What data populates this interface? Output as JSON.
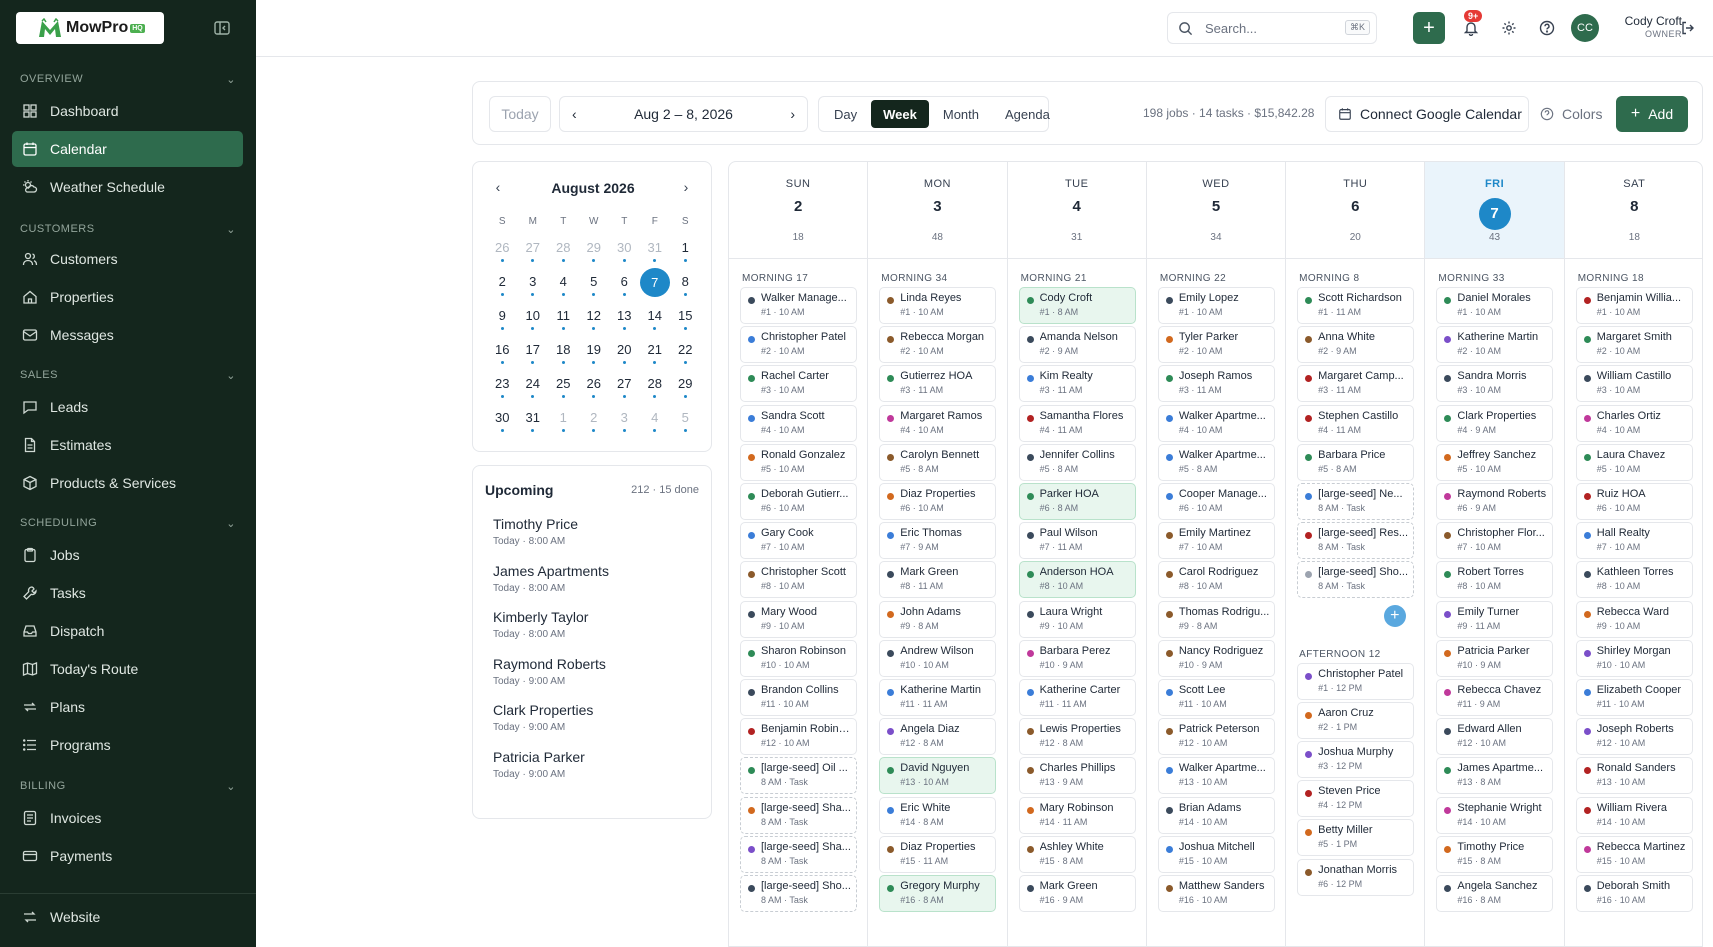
{
  "brand": {
    "name": "MowPro",
    "tag": "HQ"
  },
  "sidebar": {
    "sections": [
      {
        "label": "OVERVIEW"
      },
      {
        "label": "CUSTOMERS"
      },
      {
        "label": "SALES"
      },
      {
        "label": "SCHEDULING"
      },
      {
        "label": "BILLING"
      }
    ],
    "items": [
      {
        "label": "Dashboard"
      },
      {
        "label": "Calendar"
      },
      {
        "label": "Weather Schedule"
      },
      {
        "label": "Customers"
      },
      {
        "label": "Properties"
      },
      {
        "label": "Messages"
      },
      {
        "label": "Leads"
      },
      {
        "label": "Estimates"
      },
      {
        "label": "Products & Services"
      },
      {
        "label": "Jobs"
      },
      {
        "label": "Tasks"
      },
      {
        "label": "Dispatch"
      },
      {
        "label": "Today's Route"
      },
      {
        "label": "Plans"
      },
      {
        "label": "Programs"
      },
      {
        "label": "Invoices"
      },
      {
        "label": "Payments"
      },
      {
        "label": "Website"
      }
    ]
  },
  "topbar": {
    "search_placeholder": "Search...",
    "search_kbd": "⌘K",
    "notif_badge": "9+",
    "avatar_initials": "CC",
    "user_name": "Cody Croft",
    "user_role": "OWNER"
  },
  "toolbar": {
    "today": "Today",
    "range": "Aug 2 – 8, 2026",
    "views": [
      "Day",
      "Week",
      "Month",
      "Agenda"
    ],
    "active_view": "Week",
    "stats": "198 jobs · 14 tasks · $15,842.28",
    "gcal": "Connect Google Calendar",
    "colors": "Colors",
    "add": "Add"
  },
  "mini_calendar": {
    "title": "August 2026",
    "dow": [
      "S",
      "M",
      "T",
      "W",
      "T",
      "F",
      "S"
    ],
    "weeks": [
      [
        "26",
        "27",
        "28",
        "29",
        "30",
        "31",
        "1"
      ],
      [
        "2",
        "3",
        "4",
        "5",
        "6",
        "7",
        "8"
      ],
      [
        "9",
        "10",
        "11",
        "12",
        "13",
        "14",
        "15"
      ],
      [
        "16",
        "17",
        "18",
        "19",
        "20",
        "21",
        "22"
      ],
      [
        "23",
        "24",
        "25",
        "26",
        "27",
        "28",
        "29"
      ],
      [
        "30",
        "31",
        "1",
        "2",
        "3",
        "4",
        "5"
      ]
    ],
    "selected": "7"
  },
  "upcoming": {
    "title": "Upcoming",
    "count": "212 · 15 done",
    "items": [
      {
        "name": "Timothy Price",
        "time": "Today · 8:00 AM"
      },
      {
        "name": "James Apartments",
        "time": "Today · 8:00 AM"
      },
      {
        "name": "Kimberly Taylor",
        "time": "Today · 8:00 AM"
      },
      {
        "name": "Raymond Roberts",
        "time": "Today · 9:00 AM"
      },
      {
        "name": "Clark Properties",
        "time": "Today · 9:00 AM"
      },
      {
        "name": "Patricia Parker",
        "time": "Today · 9:00 AM"
      }
    ]
  },
  "week": {
    "days": [
      {
        "dow": "SUN",
        "num": "2",
        "count": "18",
        "morning": "MORNING 17",
        "today": false,
        "events": [
          {
            "t": "Walker Manage...",
            "s": "#1 · 10 AM",
            "c": "#3b4a5c"
          },
          {
            "t": "Christopher Patel",
            "s": "#2 · 10 AM",
            "c": "#3b7dd8"
          },
          {
            "t": "Rachel Carter",
            "s": "#3 · 10 AM",
            "c": "#2e8b57"
          },
          {
            "t": "Sandra Scott",
            "s": "#4 · 10 AM",
            "c": "#3b7dd8"
          },
          {
            "t": "Ronald Gonzalez",
            "s": "#5 · 10 AM",
            "c": "#d2691e"
          },
          {
            "t": "Deborah Gutierr...",
            "s": "#6 · 10 AM",
            "c": "#2e8b57"
          },
          {
            "t": "Gary Cook",
            "s": "#7 · 10 AM",
            "c": "#3b7dd8"
          },
          {
            "t": "Christopher Scott",
            "s": "#8 · 10 AM",
            "c": "#8b5a2b"
          },
          {
            "t": "Mary Wood",
            "s": "#9 · 10 AM",
            "c": "#3b4a5c"
          },
          {
            "t": "Sharon Robinson",
            "s": "#10 · 10 AM",
            "c": "#2e8b57"
          },
          {
            "t": "Brandon Collins",
            "s": "#11 · 10 AM",
            "c": "#3b4a5c"
          },
          {
            "t": "Benjamin Robins...",
            "s": "#12 · 10 AM",
            "c": "#b22222"
          },
          {
            "t": "[large-seed] Oil ...",
            "s": "8 AM · Task",
            "c": "#2e8b57",
            "task": true
          },
          {
            "t": "[large-seed] Sha...",
            "s": "8 AM · Task",
            "c": "#d2691e",
            "task": true
          },
          {
            "t": "[large-seed] Sha...",
            "s": "8 AM · Task",
            "c": "#7b4fc9",
            "task": true
          },
          {
            "t": "[large-seed] Sho...",
            "s": "8 AM · Task",
            "c": "#3b4a5c",
            "task": true
          }
        ]
      },
      {
        "dow": "MON",
        "num": "3",
        "count": "48",
        "morning": "MORNING 34",
        "today": false,
        "events": [
          {
            "t": "Linda Reyes",
            "s": "#1 · 10 AM",
            "c": "#8b5a2b"
          },
          {
            "t": "Rebecca Morgan",
            "s": "#2 · 10 AM",
            "c": "#8b5a2b"
          },
          {
            "t": "Gutierrez HOA",
            "s": "#3 · 11 AM",
            "c": "#2e8b57"
          },
          {
            "t": "Margaret Ramos",
            "s": "#4 · 10 AM",
            "c": "#c0399b"
          },
          {
            "t": "Carolyn Bennett",
            "s": "#5 · 8 AM",
            "c": "#8b5a2b"
          },
          {
            "t": "Diaz Properties",
            "s": "#6 · 10 AM",
            "c": "#d2691e"
          },
          {
            "t": "Eric Thomas",
            "s": "#7 · 9 AM",
            "c": "#3b7dd8"
          },
          {
            "t": "Mark Green",
            "s": "#8 · 11 AM",
            "c": "#3b4a5c"
          },
          {
            "t": "John Adams",
            "s": "#9 · 8 AM",
            "c": "#d2691e"
          },
          {
            "t": "Andrew Wilson",
            "s": "#10 · 10 AM",
            "c": "#3b4a5c"
          },
          {
            "t": "Katherine Martin",
            "s": "#11 · 11 AM",
            "c": "#3b7dd8"
          },
          {
            "t": "Angela Diaz",
            "s": "#12 · 8 AM",
            "c": "#7b4fc9"
          },
          {
            "t": "David Nguyen",
            "s": "#13 · 10 AM",
            "c": "#2e8b57",
            "green": true
          },
          {
            "t": "Eric White",
            "s": "#14 · 8 AM",
            "c": "#3b7dd8"
          },
          {
            "t": "Diaz Properties",
            "s": "#15 · 11 AM",
            "c": "#8b5a2b"
          },
          {
            "t": "Gregory Murphy",
            "s": "#16 · 8 AM",
            "c": "#2e8b57",
            "green": true
          }
        ]
      },
      {
        "dow": "TUE",
        "num": "4",
        "count": "31",
        "morning": "MORNING 21",
        "today": false,
        "events": [
          {
            "t": "Cody Croft",
            "s": "#1 · 8 AM",
            "c": "#2e8b57",
            "green": true
          },
          {
            "t": "Amanda Nelson",
            "s": "#2 · 9 AM",
            "c": "#3b4a5c"
          },
          {
            "t": "Kim Realty",
            "s": "#3 · 11 AM",
            "c": "#3b7dd8"
          },
          {
            "t": "Samantha Flores",
            "s": "#4 · 11 AM",
            "c": "#b22222"
          },
          {
            "t": "Jennifer Collins",
            "s": "#5 · 8 AM",
            "c": "#3b4a5c"
          },
          {
            "t": "Parker HOA",
            "s": "#6 · 8 AM",
            "c": "#2e8b57",
            "green": true
          },
          {
            "t": "Paul Wilson",
            "s": "#7 · 11 AM",
            "c": "#3b4a5c"
          },
          {
            "t": "Anderson HOA",
            "s": "#8 · 10 AM",
            "c": "#2e8b57",
            "green": true
          },
          {
            "t": "Laura Wright",
            "s": "#9 · 10 AM",
            "c": "#3b4a5c"
          },
          {
            "t": "Barbara Perez",
            "s": "#10 · 9 AM",
            "c": "#c0399b"
          },
          {
            "t": "Katherine Carter",
            "s": "#11 · 11 AM",
            "c": "#3b7dd8"
          },
          {
            "t": "Lewis Properties",
            "s": "#12 · 8 AM",
            "c": "#8b5a2b"
          },
          {
            "t": "Charles Phillips",
            "s": "#13 · 9 AM",
            "c": "#8b5a2b"
          },
          {
            "t": "Mary Robinson",
            "s": "#14 · 11 AM",
            "c": "#d2691e"
          },
          {
            "t": "Ashley White",
            "s": "#15 · 8 AM",
            "c": "#8b5a2b"
          },
          {
            "t": "Mark Green",
            "s": "#16 · 9 AM",
            "c": "#3b4a5c"
          }
        ]
      },
      {
        "dow": "WED",
        "num": "5",
        "count": "34",
        "morning": "MORNING 22",
        "today": false,
        "events": [
          {
            "t": "Emily Lopez",
            "s": "#1 · 10 AM",
            "c": "#3b4a5c"
          },
          {
            "t": "Tyler Parker",
            "s": "#2 · 10 AM",
            "c": "#d2691e"
          },
          {
            "t": "Joseph Ramos",
            "s": "#3 · 11 AM",
            "c": "#2e8b57"
          },
          {
            "t": "Walker Apartme...",
            "s": "#4 · 10 AM",
            "c": "#3b7dd8"
          },
          {
            "t": "Walker Apartme...",
            "s": "#5 · 8 AM",
            "c": "#3b7dd8"
          },
          {
            "t": "Cooper Manage...",
            "s": "#6 · 10 AM",
            "c": "#3b7dd8"
          },
          {
            "t": "Emily Martinez",
            "s": "#7 · 10 AM",
            "c": "#8b5a2b"
          },
          {
            "t": "Carol Rodriguez",
            "s": "#8 · 10 AM",
            "c": "#8b5a2b"
          },
          {
            "t": "Thomas Rodrigu...",
            "s": "#9 · 8 AM",
            "c": "#8b5a2b"
          },
          {
            "t": "Nancy Rodriguez",
            "s": "#10 · 9 AM",
            "c": "#8b5a2b"
          },
          {
            "t": "Scott Lee",
            "s": "#11 · 10 AM",
            "c": "#3b7dd8"
          },
          {
            "t": "Patrick Peterson",
            "s": "#12 · 10 AM",
            "c": "#8b5a2b"
          },
          {
            "t": "Walker Apartme...",
            "s": "#13 · 10 AM",
            "c": "#3b7dd8"
          },
          {
            "t": "Brian Adams",
            "s": "#14 · 10 AM",
            "c": "#3b4a5c"
          },
          {
            "t": "Joshua Mitchell",
            "s": "#15 · 10 AM",
            "c": "#3b7dd8"
          },
          {
            "t": "Matthew Sanders",
            "s": "#16 · 10 AM",
            "c": "#8b5a2b"
          }
        ]
      },
      {
        "dow": "THU",
        "num": "6",
        "count": "20",
        "morning": "MORNING 8",
        "afternoon": "AFTERNOON 12",
        "today": false,
        "events": [
          {
            "t": "Scott Richardson",
            "s": "#1 · 11 AM",
            "c": "#2e8b57"
          },
          {
            "t": "Anna White",
            "s": "#2 · 9 AM",
            "c": "#8b5a2b"
          },
          {
            "t": "Margaret Camp...",
            "s": "#3 · 11 AM",
            "c": "#b22222"
          },
          {
            "t": "Stephen Castillo",
            "s": "#4 · 11 AM",
            "c": "#b22222"
          },
          {
            "t": "Barbara Price",
            "s": "#5 · 8 AM",
            "c": "#2e8b57"
          },
          {
            "t": "[large-seed] Ne...",
            "s": "8 AM · Task",
            "c": "#3b7dd8",
            "task": true
          },
          {
            "t": "[large-seed] Res...",
            "s": "8 AM · Task",
            "c": "#b22222",
            "task": true
          },
          {
            "t": "[large-seed] Sho...",
            "s": "8 AM · Task",
            "c": "#9ca3af",
            "task": true
          }
        ],
        "afternoon_events": [
          {
            "t": "Christopher Patel",
            "s": "#1 · 12 PM",
            "c": "#7b4fc9"
          },
          {
            "t": "Aaron Cruz",
            "s": "#2 · 1 PM",
            "c": "#d2691e"
          },
          {
            "t": "Joshua Murphy",
            "s": "#3 · 12 PM",
            "c": "#7b4fc9"
          },
          {
            "t": "Steven Price",
            "s": "#4 · 12 PM",
            "c": "#b22222"
          },
          {
            "t": "Betty Miller",
            "s": "#5 · 1 PM",
            "c": "#d2691e"
          },
          {
            "t": "Jonathan Morris",
            "s": "#6 · 12 PM",
            "c": "#8b5a2b"
          }
        ]
      },
      {
        "dow": "FRI",
        "num": "7",
        "count": "43",
        "morning": "MORNING 33",
        "today": true,
        "events": [
          {
            "t": "Daniel Morales",
            "s": "#1 · 10 AM",
            "c": "#2e8b57"
          },
          {
            "t": "Katherine Martin",
            "s": "#2 · 10 AM",
            "c": "#7b4fc9"
          },
          {
            "t": "Sandra Morris",
            "s": "#3 · 10 AM",
            "c": "#3b4a5c"
          },
          {
            "t": "Clark Properties",
            "s": "#4 · 9 AM",
            "c": "#2e8b57"
          },
          {
            "t": "Jeffrey Sanchez",
            "s": "#5 · 10 AM",
            "c": "#d2691e"
          },
          {
            "t": "Raymond Roberts",
            "s": "#6 · 9 AM",
            "c": "#c0399b"
          },
          {
            "t": "Christopher Flor...",
            "s": "#7 · 10 AM",
            "c": "#8b5a2b"
          },
          {
            "t": "Robert Torres",
            "s": "#8 · 10 AM",
            "c": "#2e8b57"
          },
          {
            "t": "Emily Turner",
            "s": "#9 · 11 AM",
            "c": "#7b4fc9"
          },
          {
            "t": "Patricia Parker",
            "s": "#10 · 9 AM",
            "c": "#d2691e"
          },
          {
            "t": "Rebecca Chavez",
            "s": "#11 · 9 AM",
            "c": "#c0399b"
          },
          {
            "t": "Edward Allen",
            "s": "#12 · 10 AM",
            "c": "#3b4a5c"
          },
          {
            "t": "James Apartme...",
            "s": "#13 · 8 AM",
            "c": "#2e8b57"
          },
          {
            "t": "Stephanie Wright",
            "s": "#14 · 10 AM",
            "c": "#c0399b"
          },
          {
            "t": "Timothy Price",
            "s": "#15 · 8 AM",
            "c": "#d2691e"
          },
          {
            "t": "Angela Sanchez",
            "s": "#16 · 8 AM",
            "c": "#3b4a5c"
          }
        ]
      },
      {
        "dow": "SAT",
        "num": "8",
        "count": "18",
        "morning": "MORNING 18",
        "today": false,
        "events": [
          {
            "t": "Benjamin Willia...",
            "s": "#1 · 10 AM",
            "c": "#b22222"
          },
          {
            "t": "Margaret Smith",
            "s": "#2 · 10 AM",
            "c": "#2e8b57"
          },
          {
            "t": "William Castillo",
            "s": "#3 · 10 AM",
            "c": "#3b4a5c"
          },
          {
            "t": "Charles Ortiz",
            "s": "#4 · 10 AM",
            "c": "#c0399b"
          },
          {
            "t": "Laura Chavez",
            "s": "#5 · 10 AM",
            "c": "#2e8b57"
          },
          {
            "t": "Ruiz HOA",
            "s": "#6 · 10 AM",
            "c": "#b22222"
          },
          {
            "t": "Hall Realty",
            "s": "#7 · 10 AM",
            "c": "#3b7dd8"
          },
          {
            "t": "Kathleen Torres",
            "s": "#8 · 10 AM",
            "c": "#3b4a5c"
          },
          {
            "t": "Rebecca Ward",
            "s": "#9 · 10 AM",
            "c": "#d2691e"
          },
          {
            "t": "Shirley Morgan",
            "s": "#10 · 10 AM",
            "c": "#7b4fc9"
          },
          {
            "t": "Elizabeth Cooper",
            "s": "#11 · 10 AM",
            "c": "#3b7dd8"
          },
          {
            "t": "Joseph Roberts",
            "s": "#12 · 10 AM",
            "c": "#7b4fc9"
          },
          {
            "t": "Ronald Sanders",
            "s": "#13 · 10 AM",
            "c": "#b22222"
          },
          {
            "t": "William Rivera",
            "s": "#14 · 10 AM",
            "c": "#b22222"
          },
          {
            "t": "Rebecca Martinez",
            "s": "#15 · 10 AM",
            "c": "#c0399b"
          },
          {
            "t": "Deborah Smith",
            "s": "#16 · 10 AM",
            "c": "#3b4a5c"
          }
        ]
      }
    ]
  }
}
